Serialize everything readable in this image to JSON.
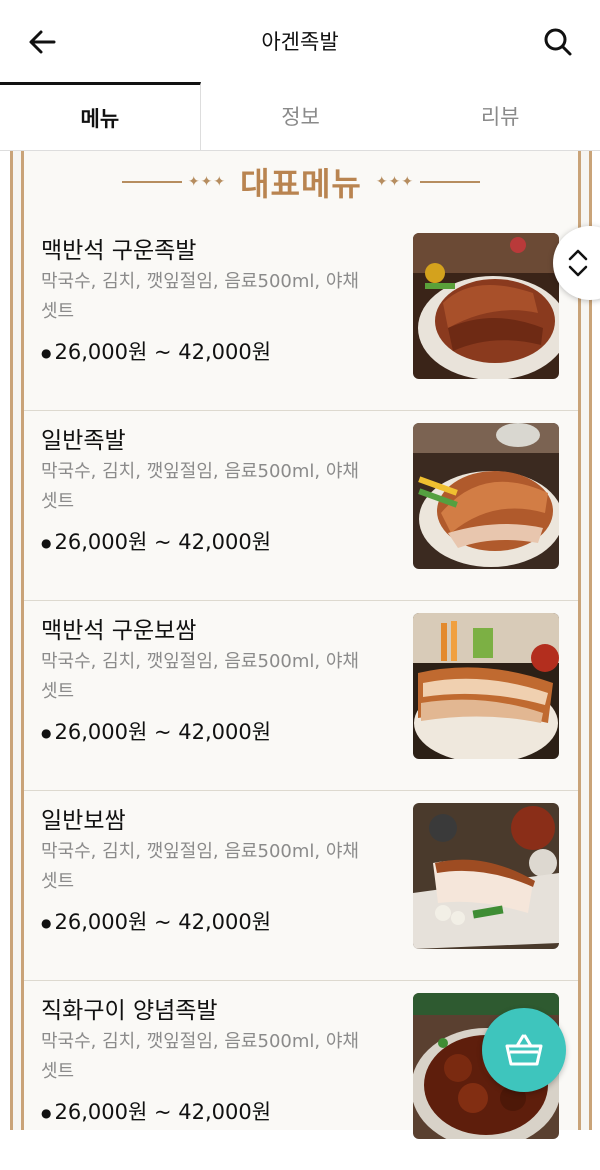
{
  "header": {
    "title": "아겐족발"
  },
  "tabs": [
    {
      "label": "메뉴",
      "active": true
    },
    {
      "label": "정보",
      "active": false
    },
    {
      "label": "리뷰",
      "active": false
    }
  ],
  "section": {
    "title": "대표메뉴",
    "deco_left": "✦✦✦",
    "deco_right": "✦✦✦"
  },
  "menu_items": [
    {
      "name": "맥반석 구운족발",
      "desc": "막국수, 김치, 깻잎절임, 음료500ml, 야채셋트",
      "price": "26,000원 ~ 42,000원",
      "image": "jokbal-platter-photo"
    },
    {
      "name": "일반족발",
      "desc": "막국수, 김치, 깻잎절임, 음료500ml, 야채셋트",
      "price": "26,000원 ~ 42,000원",
      "image": "jokbal-platter-photo"
    },
    {
      "name": "맥반석 구운보쌈",
      "desc": "막국수, 김치, 깻잎절임, 음료500ml, 야채셋트",
      "price": "26,000원 ~ 42,000원",
      "image": "bossam-platter-photo"
    },
    {
      "name": "일반보쌈",
      "desc": "막국수, 김치, 깻잎절임, 음료500ml, 야채셋트",
      "price": "26,000원 ~ 42,000원",
      "image": "bossam-platter-photo"
    },
    {
      "name": "직화구이 양념족발",
      "desc": "막국수, 김치, 깻잎절임, 음료500ml, 야채셋트",
      "price": "26,000원 ~ 42,000원",
      "image": "spicy-jokbal-photo"
    }
  ],
  "colors": {
    "accent": "#c9a378",
    "cart": "#3ec5bd",
    "section_title": "#b98450"
  },
  "icons": {
    "back": "arrow-left-icon",
    "search": "search-icon",
    "scroll": "chevron-up-down-icon",
    "cart": "basket-icon"
  }
}
